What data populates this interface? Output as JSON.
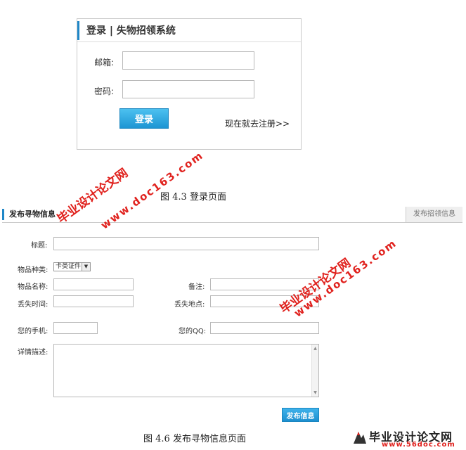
{
  "login": {
    "title": "登录 | 失物招领系统",
    "email_label": "邮箱:",
    "password_label": "密码:",
    "submit_label": "登录",
    "register_link": "现在就去注册>>"
  },
  "captions": {
    "login": "图 4.3 登录页面",
    "publish": "图 4.6 发布寻物信息页面"
  },
  "publish_form": {
    "tab_active": "发布寻物信息",
    "tab_other": "发布招领信息",
    "title_label": "标题:",
    "category_label": "物品种类:",
    "category_value": "卡类证件",
    "name_label": "物品名称:",
    "remark_label": "备注:",
    "lost_time_label": "丢失时间:",
    "lost_place_label": "丢失地点:",
    "phone_label": "您的手机:",
    "qq_label": "您的QQ:",
    "detail_label": "详情描述:",
    "submit_label": "发布信息"
  },
  "watermarks": {
    "site_cn": "毕业设计论文网",
    "site_url": "www.doc163.com",
    "logo_cn": "毕业设计论文网",
    "logo_url": "www.56doc.com"
  },
  "colors": {
    "accent_blue": "#1f87c8",
    "button_blue": "#1d95d3",
    "watermark_red": "#e0211d"
  }
}
